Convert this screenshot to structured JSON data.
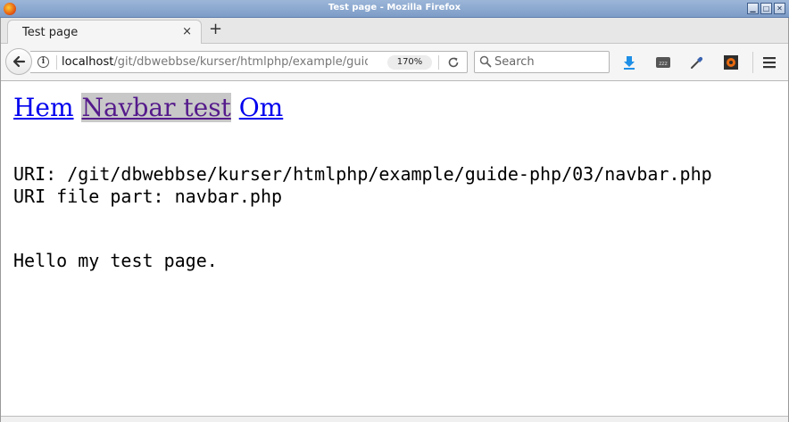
{
  "window": {
    "title": "Test page - Mozilla Firefox",
    "controls": {
      "minimize": "▁",
      "maximize": "□",
      "close": "✕"
    }
  },
  "tabs": [
    {
      "label": "Test page",
      "close": "×",
      "active": true
    }
  ],
  "newtab_label": "+",
  "navbar": {
    "url_host": "localhost",
    "url_path": "/git/dbwebbse/kurser/htmlphp/example/guide-php/03/navbar.php",
    "zoom": "170%",
    "search_placeholder": "Search",
    "icons": [
      "back-arrow-icon",
      "info-icon",
      "reload-icon",
      "search-icon",
      "download-icon",
      "sleep-tab-icon",
      "eyedropper-icon",
      "extension-gear-icon",
      "hamburger-menu-icon"
    ]
  },
  "page": {
    "nav": [
      {
        "label": "Hem",
        "selected": false
      },
      {
        "label": "Navbar test",
        "selected": true
      },
      {
        "label": "Om",
        "selected": false
      }
    ],
    "uri_line": "URI: /git/dbwebbse/kurser/htmlphp/example/guide-php/03/navbar.php",
    "file_line": "URI file part: navbar.php",
    "hello_line": "Hello my test page."
  },
  "colors": {
    "link": "#0000ee",
    "visited_selected": "#551a8b",
    "selected_bg": "#c8c8c8",
    "titlebar": "#8aa7d0"
  }
}
